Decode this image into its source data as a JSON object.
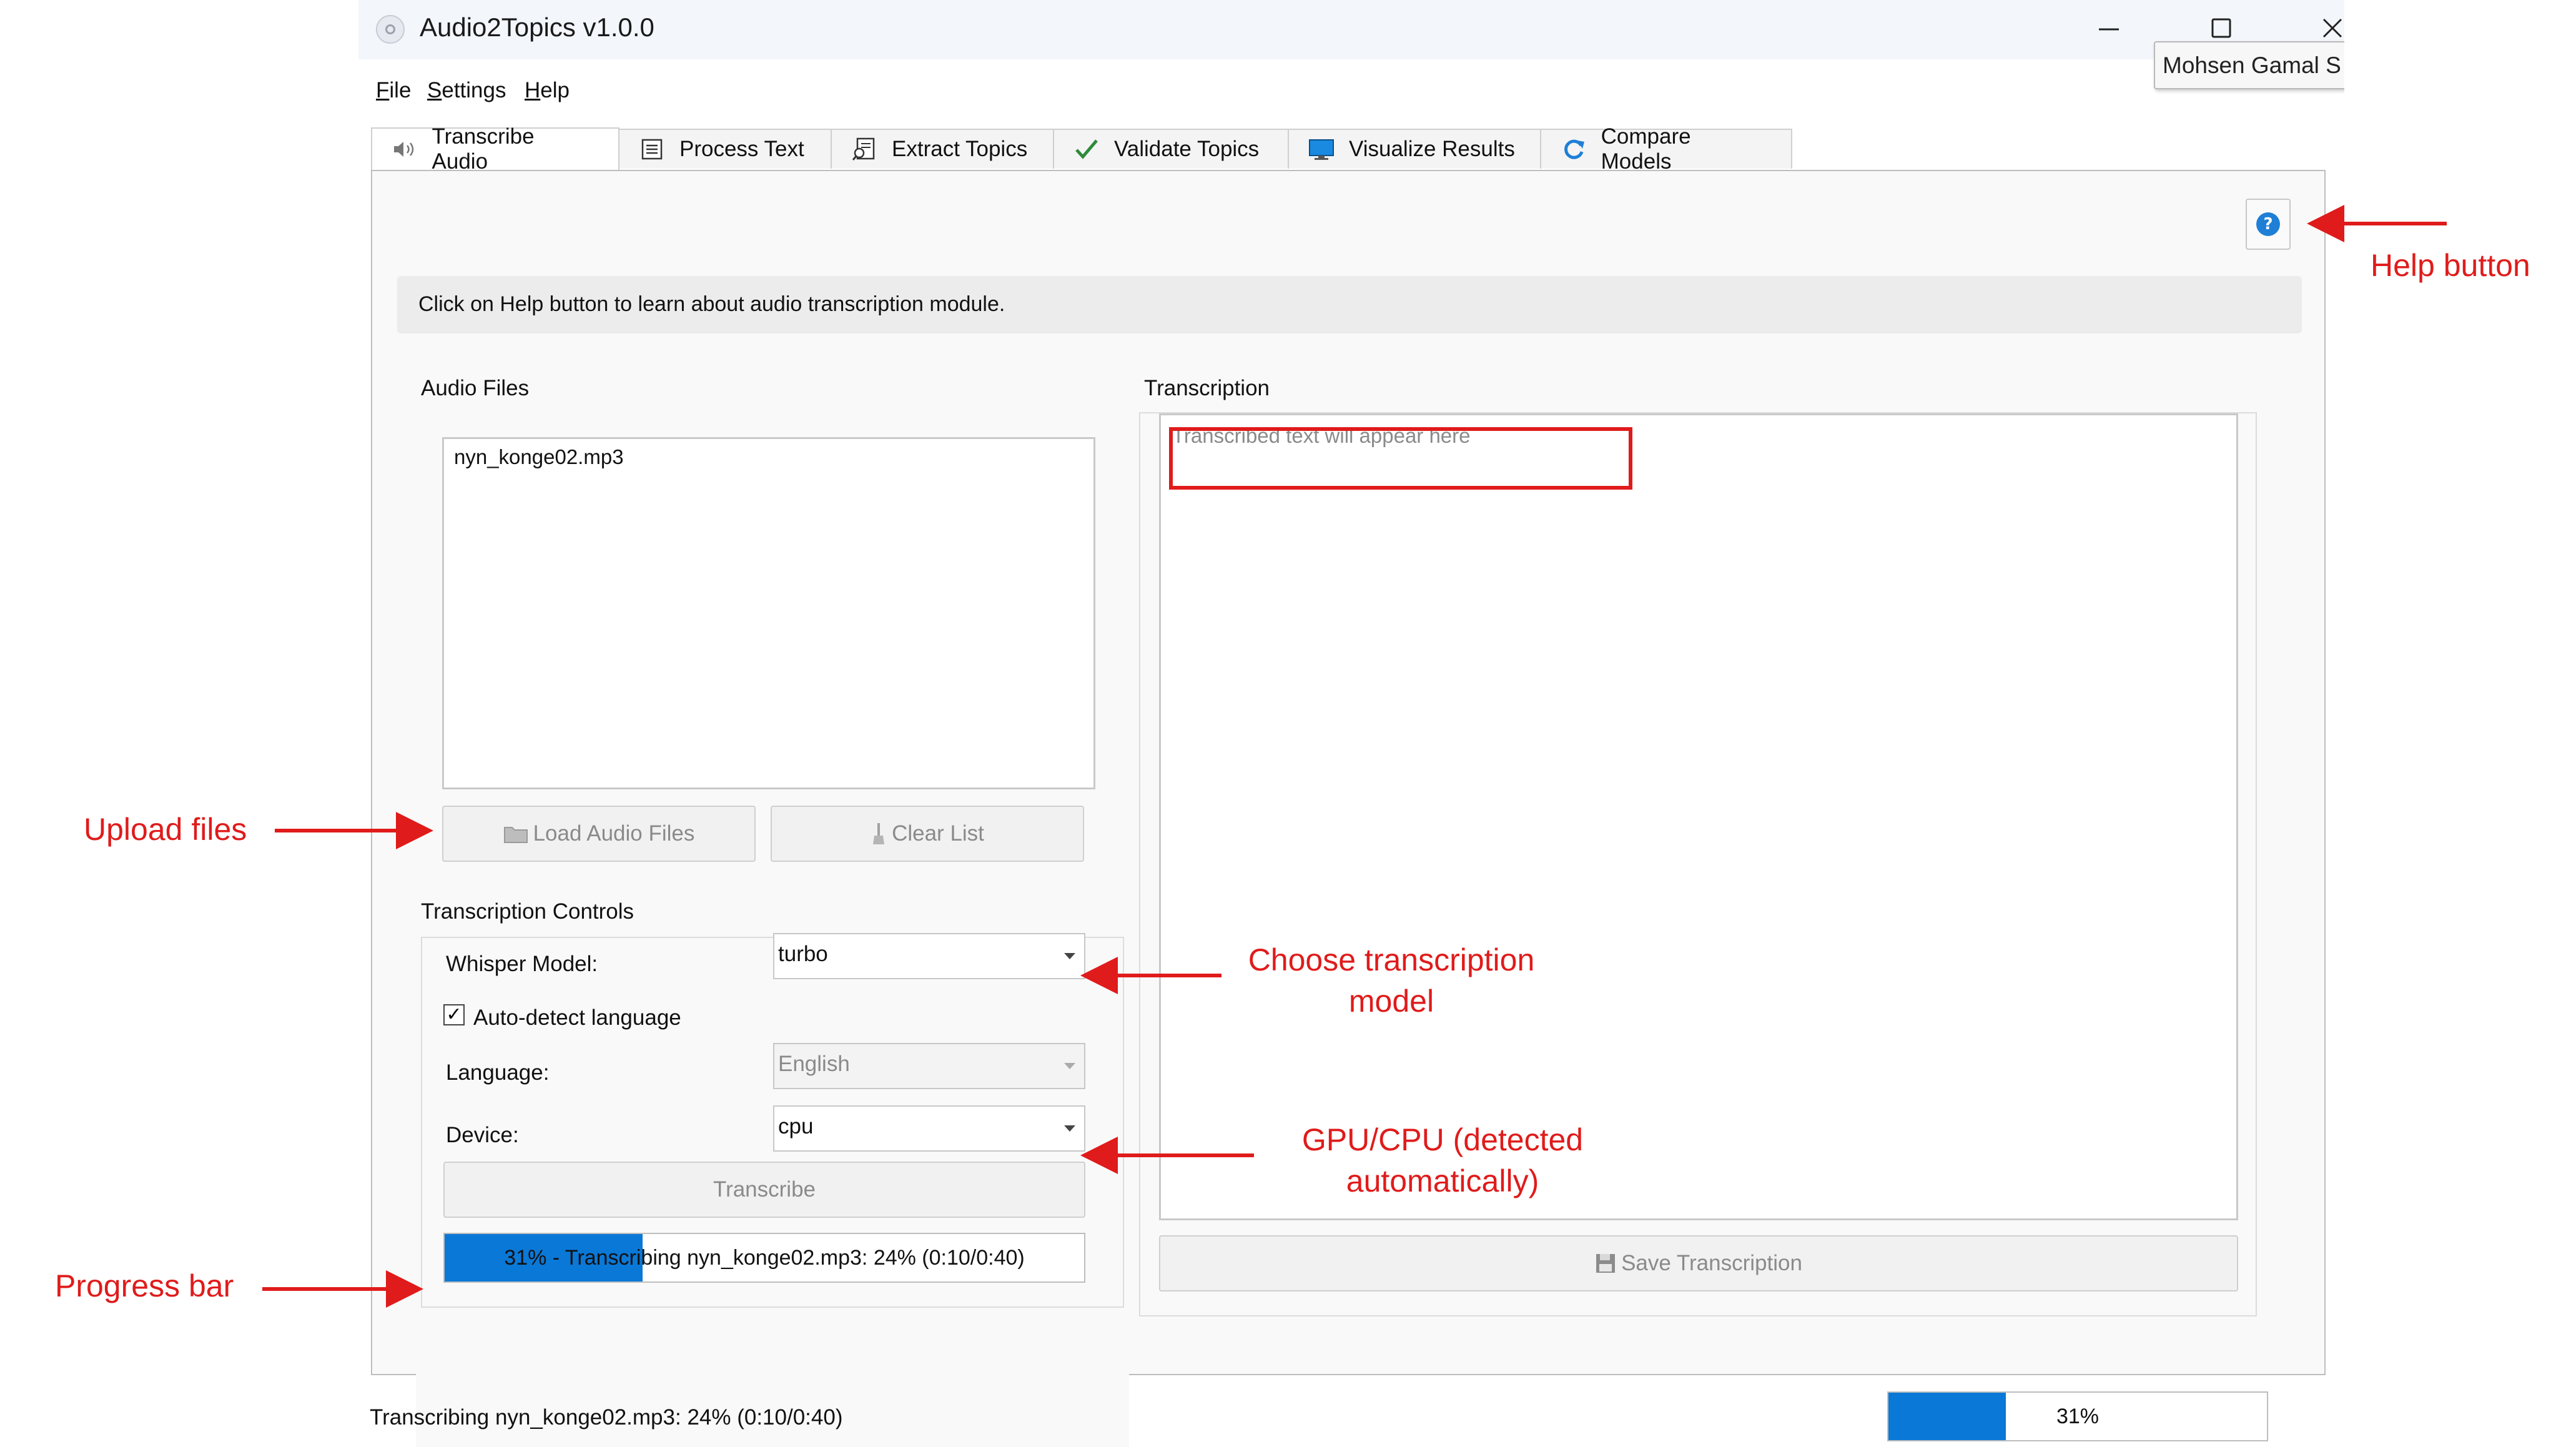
{
  "window": {
    "title": "Audio2Topics v1.0.0",
    "controls": {
      "minimize": "—",
      "maximize": "☐",
      "close": "✕"
    },
    "tooltip": "Mohsen Gamal S"
  },
  "menu": [
    {
      "label": "File"
    },
    {
      "label": "Settings"
    },
    {
      "label": "Help"
    }
  ],
  "tabs": [
    {
      "label": "Transcribe Audio",
      "icon": "speaker-icon",
      "active": true
    },
    {
      "label": "Process Text",
      "icon": "document-icon"
    },
    {
      "label": "Extract Topics",
      "icon": "extract-icon"
    },
    {
      "label": "Validate Topics",
      "icon": "checkmark-icon"
    },
    {
      "label": "Visualize Results",
      "icon": "monitor-icon"
    },
    {
      "label": "Compare Models",
      "icon": "refresh-icon"
    }
  ],
  "panel": {
    "help_icon_glyph": "?",
    "info_text": "Click on Help button to learn about audio transcription module.",
    "audio_files": {
      "heading": "Audio Files",
      "files": [
        "nyn_konge02.mp3"
      ],
      "load_button": "Load Audio Files",
      "clear_button": "Clear List"
    },
    "controls": {
      "heading": "Transcription Controls",
      "whisper_model_label": "Whisper Model:",
      "whisper_model_value": "turbo",
      "auto_detect_label": "Auto-detect language",
      "auto_detect_checked": true,
      "language_label": "Language:",
      "language_value": "English",
      "device_label": "Device:",
      "device_value": "cpu",
      "transcribe_button": "Transcribe",
      "progress_text": "31% - Transcribing nyn_konge02.mp3: 24% (0:10/0:40)",
      "progress_percent": 31
    },
    "transcription": {
      "heading": "Transcription",
      "placeholder": "Transcribed text will appear here",
      "save_button": "Save Transcription"
    }
  },
  "statusbar": {
    "text": "Transcribing nyn_konge02.mp3: 24% (0:10/0:40)",
    "progress_text": "31%",
    "progress_percent": 31
  },
  "annotations": {
    "help": "Help button",
    "upload": "Upload files",
    "model": "Choose transcription model",
    "model_line1": "Choose transcription",
    "model_line2": "model",
    "device_line1": "GPU/CPU (detected",
    "device_line2": "automatically)",
    "progress": "Progress bar",
    "color": "#e01b1b"
  },
  "colors": {
    "accent": "#0a78d7",
    "help_icon": "#1f7fd6",
    "annotation": "#e01b1b"
  }
}
